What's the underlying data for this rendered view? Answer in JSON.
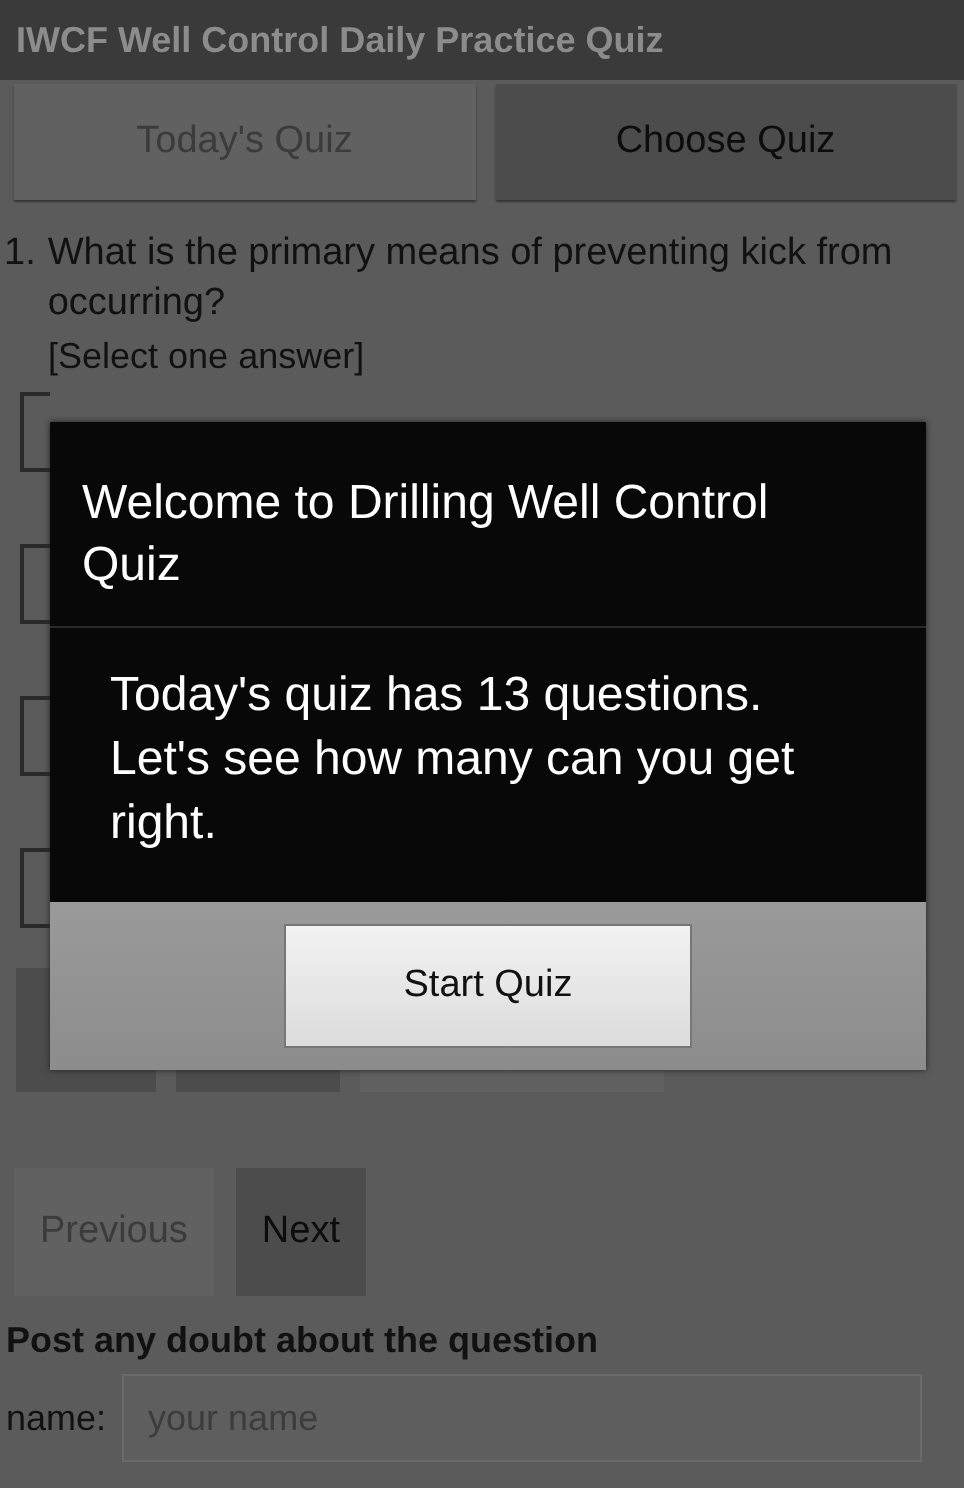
{
  "app_bar": {
    "title": "IWCF Well Control Daily Practice Quiz"
  },
  "tabs": [
    {
      "label": "Today's Quiz",
      "disabled": true
    },
    {
      "label": "Choose Quiz",
      "disabled": false
    }
  ],
  "question": {
    "number": "1.",
    "text": "What is the primary means of preventing kick from occurring?",
    "instruction": "[Select one answer]",
    "options": [
      {
        "kind": "checkbox",
        "checked": false
      },
      {
        "kind": "checkbox",
        "checked": false
      },
      {
        "kind": "checkbox",
        "checked": false
      },
      {
        "kind": "checkbox",
        "checked": false
      }
    ]
  },
  "action_buttons": [
    {
      "disabled": false
    },
    {
      "disabled": false
    },
    {
      "disabled": true
    }
  ],
  "nav_buttons": [
    {
      "label": "Previous",
      "disabled": true
    },
    {
      "label": "Next",
      "disabled": false
    }
  ],
  "doubt": {
    "heading": "Post any doubt about the question",
    "name_label": "name:",
    "name_placeholder": "your name"
  },
  "dialog": {
    "title": "Welcome to Drilling Well Control Quiz",
    "message": "Today's quiz has 13 questions. Let's see how many can you get right.",
    "button": "Start Quiz"
  }
}
